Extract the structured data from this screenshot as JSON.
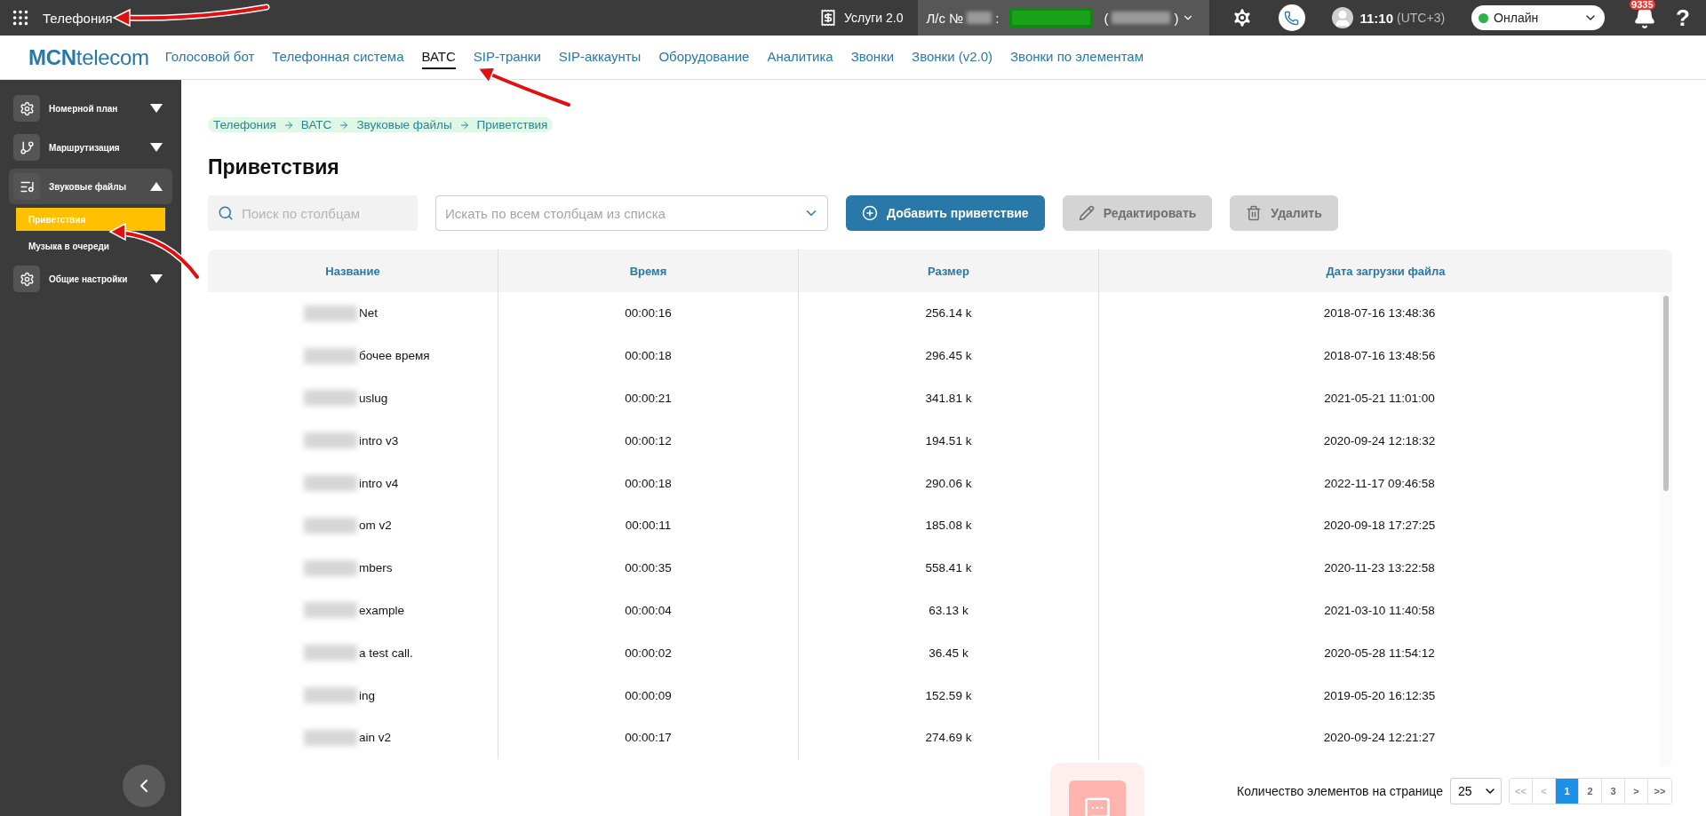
{
  "top_bar": {
    "app_title": "Телефония",
    "services_label": "Услуги 2.0",
    "account": {
      "label": "Л/с №",
      "separator": ":",
      "open_paren": "(",
      "close_paren": ")"
    },
    "time": "11:10",
    "timezone": "(UTC+3)",
    "status": {
      "label": "Онлайн"
    },
    "notifications_badge": "9335",
    "help": "?"
  },
  "nav": {
    "logo": "**MCN**telecom",
    "tabs": [
      {
        "label": "Голосовой бот",
        "selected": false
      },
      {
        "label": "Телефонная система",
        "selected": false
      },
      {
        "label": "ВАТС",
        "selected": true
      },
      {
        "label": "SIP-транки",
        "selected": false
      },
      {
        "label": "SIP-аккаунты",
        "selected": false
      },
      {
        "label": "Оборудование",
        "selected": false
      },
      {
        "label": "Аналитика",
        "selected": false
      },
      {
        "label": "Звонки",
        "selected": false
      },
      {
        "label": "Звонки (v2.0)",
        "selected": false
      },
      {
        "label": "Звонки по элементам",
        "selected": false
      }
    ]
  },
  "sidebar": {
    "items": [
      {
        "label": "Номерной план",
        "kind": "gear",
        "expanded": false
      },
      {
        "label": "Маршрутизация",
        "kind": "branch",
        "expanded": false
      },
      {
        "label": "Звуковые файлы",
        "kind": "audio",
        "expanded": true,
        "children": [
          {
            "label": "Приветствия",
            "selected": true
          },
          {
            "label": "Музыка в очереди",
            "selected": false
          }
        ]
      },
      {
        "label": "Общие настройки",
        "kind": "gear",
        "expanded": false
      }
    ]
  },
  "breadcrumb": [
    "Телефония",
    "ВАТС",
    "Звуковые файлы",
    "Приветствия"
  ],
  "page_title": "Приветствия",
  "toolbar": {
    "search": {
      "placeholder": "Поиск по столбцам"
    },
    "filter": {
      "placeholder": "Искать по всем столбцам из списка"
    },
    "buttons": [
      {
        "label": "Добавить приветствие",
        "kind": "add",
        "disabled": false
      },
      {
        "label": "Редактировать",
        "kind": "edit",
        "disabled": true
      },
      {
        "label": "Удалить",
        "kind": "delete",
        "disabled": true
      }
    ]
  },
  "table": {
    "columns": [
      "Название",
      "Время",
      "Размер",
      "Дата загрузки файла"
    ],
    "rows": [
      {
        "name": "Net",
        "redacted": true,
        "time": "00:00:16",
        "size": "256.14 k",
        "uploaded": "2018-07-16 13:48:36"
      },
      {
        "name": "бочее время",
        "redacted": true,
        "time": "00:00:18",
        "size": "296.45 k",
        "uploaded": "2018-07-16 13:48:56"
      },
      {
        "name": "uslug",
        "redacted": true,
        "time": "00:00:21",
        "size": "341.81 k",
        "uploaded": "2021-05-21 11:01:00"
      },
      {
        "name": "intro v3",
        "redacted": true,
        "time": "00:00:12",
        "size": "194.51 k",
        "uploaded": "2020-09-24 12:18:32"
      },
      {
        "name": "intro v4",
        "redacted": true,
        "time": "00:00:18",
        "size": "290.06 k",
        "uploaded": "2022-11-17 09:46:58"
      },
      {
        "name": "om v2",
        "redacted": true,
        "time": "00:00:11",
        "size": "185.08 k",
        "uploaded": "2020-09-18 17:27:25"
      },
      {
        "name": "mbers",
        "redacted": true,
        "time": "00:00:35",
        "size": "558.41 k",
        "uploaded": "2020-11-23 13:22:58"
      },
      {
        "name": "example",
        "redacted": true,
        "time": "00:00:04",
        "size": "63.13 k",
        "uploaded": "2021-03-10 11:40:58"
      },
      {
        "name": "a test call.",
        "redacted": true,
        "time": "00:00:02",
        "size": "36.45 k",
        "uploaded": "2020-05-28 11:54:12"
      },
      {
        "name": "ing",
        "redacted": true,
        "time": "00:00:09",
        "size": "152.59 k",
        "uploaded": "2019-05-20 16:12:35"
      },
      {
        "name": "ain v2",
        "redacted": true,
        "time": "00:00:17",
        "size": "274.69 k",
        "uploaded": "2020-09-24 12:21:27"
      }
    ]
  },
  "pagination": {
    "label": "Количество элементов на странице",
    "page_size": "25",
    "buttons": [
      {
        "label": "<<",
        "disabled": true,
        "selected": false
      },
      {
        "label": "<",
        "disabled": true,
        "selected": false
      },
      {
        "label": "1",
        "disabled": false,
        "selected": true
      },
      {
        "label": "2",
        "disabled": false,
        "selected": false
      },
      {
        "label": "3",
        "disabled": false,
        "selected": false
      },
      {
        "label": ">",
        "disabled": false,
        "selected": false
      },
      {
        "label": ">>",
        "disabled": false,
        "selected": false
      }
    ]
  }
}
